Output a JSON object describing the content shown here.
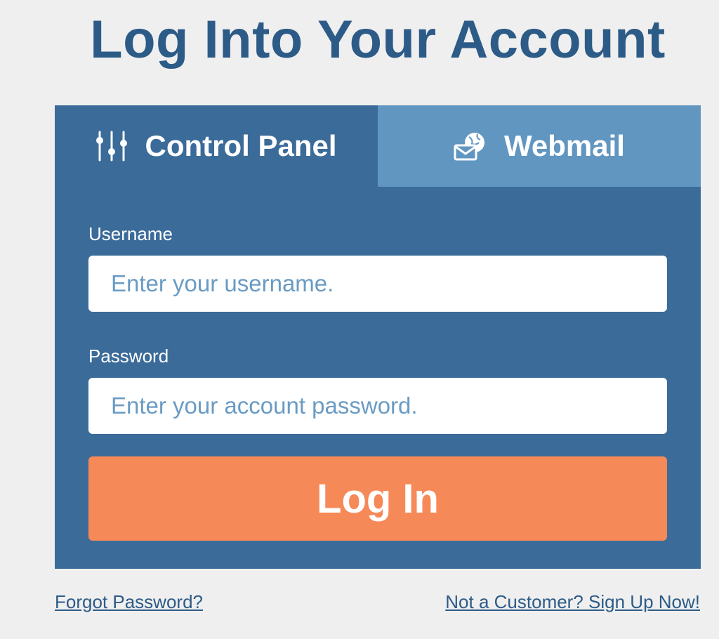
{
  "page": {
    "title": "Log Into Your Account"
  },
  "tabs": [
    {
      "label": "Control Panel",
      "icon": "sliders-icon",
      "active": true
    },
    {
      "label": "Webmail",
      "icon": "envelope-globe-icon",
      "active": false
    }
  ],
  "form": {
    "username_label": "Username",
    "username_placeholder": "Enter your username.",
    "username_value": "",
    "password_label": "Password",
    "password_placeholder": "Enter your account password.",
    "password_value": "",
    "submit_label": "Log In"
  },
  "footer": {
    "forgot_password": "Forgot Password?",
    "sign_up": "Not a Customer? Sign Up Now!"
  },
  "colors": {
    "background": "#efefef",
    "title": "#2d5b87",
    "panel": "#3b6b99",
    "inactive_tab": "#6196c0",
    "button": "#f68958",
    "placeholder": "#6a9bc3",
    "link": "#2d5b87"
  }
}
